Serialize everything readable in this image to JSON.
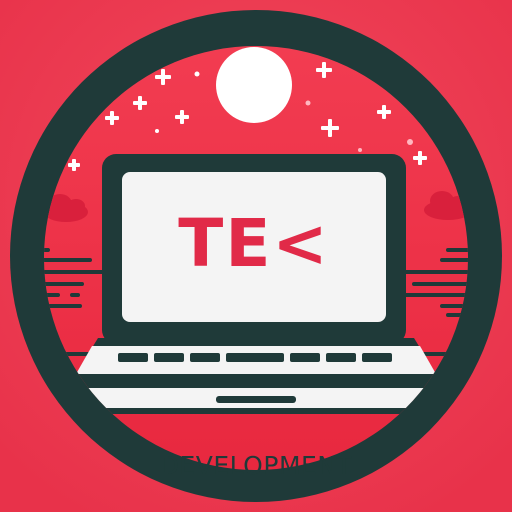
{
  "logo": {
    "wordmark": "TE<",
    "caption": "DEVELOPMENT"
  },
  "colors": {
    "background": "#ef3b52",
    "ring": "#1f3a39",
    "accent": "#e32647",
    "screen": "#f4f4f4",
    "caption_text": "#1f3a39",
    "wordmark_text": "#e12a48"
  },
  "icons": [
    "sun-icon",
    "sparkle-icon",
    "cloud-icon",
    "laptop-icon"
  ]
}
